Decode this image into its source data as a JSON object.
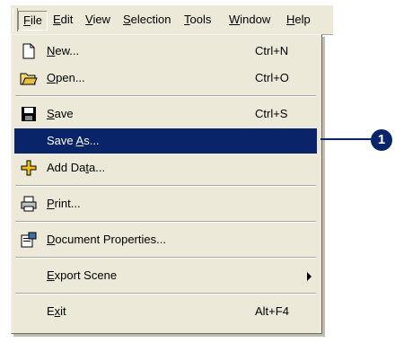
{
  "menubar": {
    "items": [
      {
        "label": "File",
        "active": true
      },
      {
        "label": "Edit"
      },
      {
        "label": "View"
      },
      {
        "label": "Selection"
      },
      {
        "label": "Tools"
      },
      {
        "label": "Window"
      },
      {
        "label": "Help"
      }
    ]
  },
  "file_menu": {
    "items": [
      {
        "label": "New...",
        "shortcut": "Ctrl+N",
        "icon": "new-document-icon"
      },
      {
        "label": "Open...",
        "shortcut": "Ctrl+O",
        "icon": "open-folder-icon"
      },
      {
        "label": "Save",
        "shortcut": "Ctrl+S",
        "icon": "save-disk-icon"
      },
      {
        "label": "Save As...",
        "highlighted": true
      },
      {
        "label": "Add Data...",
        "icon": "add-data-icon"
      },
      {
        "label": "Print...",
        "icon": "printer-icon"
      },
      {
        "label": "Document Properties...",
        "icon": "document-properties-icon"
      },
      {
        "label": "Export Scene",
        "submenu": true
      },
      {
        "label": "Exit",
        "shortcut": "Alt+F4"
      }
    ]
  },
  "callout": {
    "number": "1"
  },
  "colors": {
    "highlight": "#0a246a",
    "menu_bg": "#ece9d8"
  }
}
